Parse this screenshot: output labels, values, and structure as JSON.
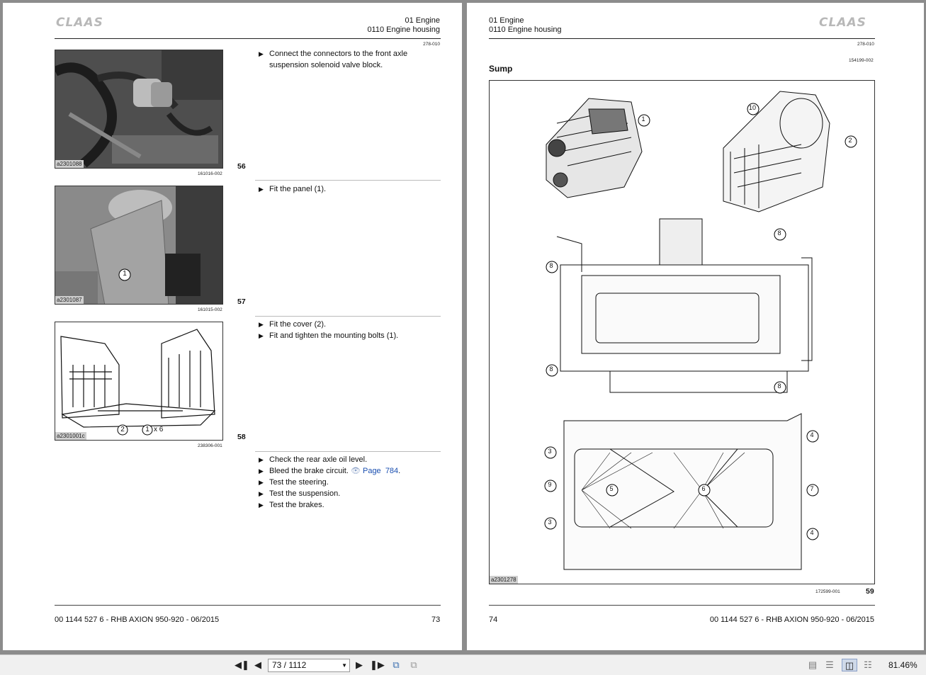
{
  "left_page": {
    "brand": "CLAAS",
    "header_line1": "01 Engine",
    "header_line2": "0110 Engine housing",
    "code": "278-010",
    "figures": [
      {
        "label": "a2301088",
        "ref": "161016-002",
        "number": "56"
      },
      {
        "label": "a2301087",
        "ref": "161015-002",
        "number": "57",
        "callout": "1"
      },
      {
        "label": "a2301001c",
        "ref": "238306-001",
        "number": "58",
        "callout_a": "2",
        "callout_b": "1",
        "callout_b_suffix": "x 6"
      }
    ],
    "steps_1": [
      "Connect the connectors to the front axle suspension solenoid valve block."
    ],
    "steps_2": [
      "Fit the panel (1)."
    ],
    "steps_3": [
      "Fit the cover (2).",
      "Fit and tighten the mounting bolts (1)."
    ],
    "steps_4": {
      "s1": "Check the rear axle oil level.",
      "s2_text": "Bleed the brake circuit.",
      "s2_link_icon": "eye-icon",
      "s2_link_page": "Page",
      "s2_link_num": "784",
      "s3": "Test the steering.",
      "s4": "Test the suspension.",
      "s5": "Test the brakes."
    },
    "footer_doc": "00 1144 527 6 - RHB AXION 950-920 - 06/2015",
    "footer_page": "73"
  },
  "right_page": {
    "brand": "CLAAS",
    "header_line1": "01 Engine",
    "header_line2": "0110 Engine housing",
    "code": "278-010",
    "subcode": "154199-002",
    "section_title": "Sump",
    "figure": {
      "label": "a2301278",
      "ref": "172599-001",
      "number": "59"
    },
    "callouts": [
      "1",
      "10",
      "2",
      "8",
      "8",
      "8",
      "8",
      "3",
      "9",
      "3",
      "5",
      "6",
      "4",
      "7",
      "4"
    ],
    "footer_page": "74",
    "footer_doc": "00 1144 527 6 - RHB AXION 950-920 - 06/2015"
  },
  "toolbar": {
    "page_value": "73 / 1112",
    "zoom": "81.46%",
    "icons": [
      "first-page-icon",
      "prev-page-icon",
      "next-page-icon",
      "last-page-icon",
      "back-view-icon",
      "forward-view-icon",
      "single-page-icon",
      "continuous-icon",
      "two-page-icon",
      "two-page-continuous-icon"
    ]
  }
}
